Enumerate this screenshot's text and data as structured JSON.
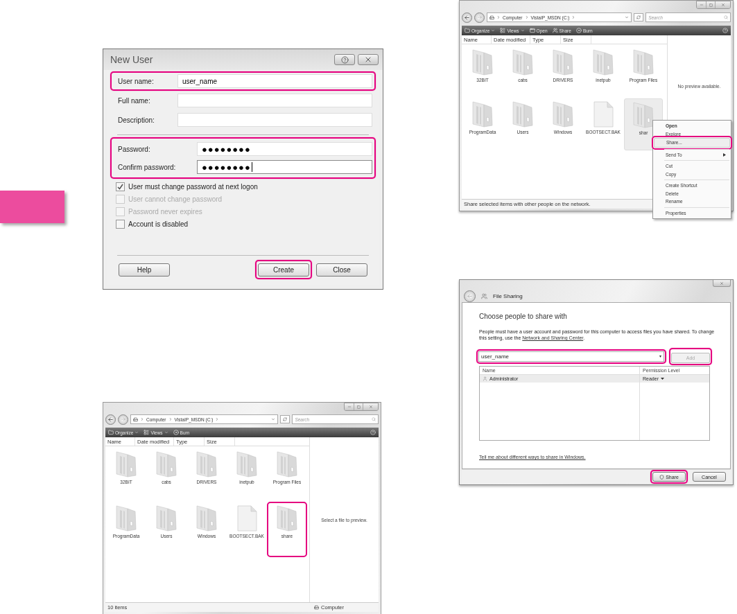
{
  "new_user_dialog": {
    "title": "New User",
    "name_fields": [
      {
        "label": "User name:",
        "value": "user_name",
        "highlighted": true
      },
      {
        "label": "Full name:",
        "highlighted": false
      },
      {
        "label": "Description:",
        "highlighted": false
      }
    ],
    "password_group": {
      "highlighted": true,
      "fields": [
        {
          "label": "Password:",
          "value": "●●●●●●●●",
          "caret": false
        },
        {
          "label": "Confirm password:",
          "value": "●●●●●●●●",
          "caret": true
        }
      ]
    },
    "options": [
      {
        "label": "User must change password at next logon",
        "checked": true,
        "disabled": false
      },
      {
        "label": "User cannot change password",
        "checked": false,
        "disabled": true
      },
      {
        "label": "Password never expires",
        "checked": false,
        "disabled": true
      },
      {
        "label": "Account is disabled",
        "checked": false,
        "disabled": false
      }
    ],
    "buttons": [
      {
        "label": "Help",
        "highlighted": false
      },
      {
        "label": "Create",
        "highlighted": true
      },
      {
        "label": "Close",
        "highlighted": false
      }
    ]
  },
  "explorer_windows": [
    {
      "path": [
        "Computer",
        "VistaIP_MSDN (C:)"
      ],
      "search_placeholder": "Search",
      "toolbar": [
        {
          "label": "Organize",
          "kind": "organize",
          "dropdown": true
        },
        {
          "label": "Views",
          "kind": "views",
          "dropdown": true
        },
        {
          "label": "Burn",
          "kind": "burn",
          "dropdown": false
        }
      ],
      "columns": [
        "Name",
        "Date modified",
        "Type",
        "Size"
      ],
      "items": [
        {
          "label": "32BIT",
          "kind": "folder",
          "selected": false,
          "highlighted": false
        },
        {
          "label": "cabs",
          "kind": "folder",
          "selected": false,
          "highlighted": false
        },
        {
          "label": "DRIVERS",
          "kind": "folder",
          "selected": false,
          "highlighted": false
        },
        {
          "label": "inetpub",
          "kind": "folder",
          "selected": false,
          "highlighted": false
        },
        {
          "label": "Program Files",
          "kind": "folder",
          "selected": false,
          "highlighted": false
        },
        {
          "label": "ProgramData",
          "kind": "folder",
          "selected": false,
          "highlighted": false
        },
        {
          "label": "Users",
          "kind": "folder",
          "selected": false,
          "highlighted": false
        },
        {
          "label": "Windows",
          "kind": "folder",
          "selected": false,
          "highlighted": false
        },
        {
          "label": "BOOTSECT.BAK",
          "kind": "file",
          "selected": false,
          "highlighted": false
        },
        {
          "label": "share",
          "kind": "folder",
          "selected": false,
          "highlighted": true
        }
      ],
      "preview_text": "Select a file to preview.",
      "status": {
        "text": "10 items",
        "location": "Computer"
      }
    },
    {
      "path": [
        "Computer",
        "VistaIP_MSDN (C:)"
      ],
      "search_placeholder": "Search",
      "toolbar": [
        {
          "label": "Organize",
          "kind": "organize",
          "dropdown": true
        },
        {
          "label": "Views",
          "kind": "views",
          "dropdown": true
        },
        {
          "label": "Open",
          "kind": "open",
          "dropdown": false
        },
        {
          "label": "Share",
          "kind": "share",
          "dropdown": false
        },
        {
          "label": "Burn",
          "kind": "burn",
          "dropdown": false
        }
      ],
      "columns": [
        "Name",
        "Date modified",
        "Type",
        "Size"
      ],
      "items": [
        {
          "label": "32BIT",
          "kind": "folder",
          "selected": false,
          "highlighted": false
        },
        {
          "label": "cabs",
          "kind": "folder",
          "selected": false,
          "highlighted": false
        },
        {
          "label": "DRIVERS",
          "kind": "folder",
          "selected": false,
          "highlighted": false
        },
        {
          "label": "inetpub",
          "kind": "folder",
          "selected": false,
          "highlighted": false
        },
        {
          "label": "Program Files",
          "kind": "folder",
          "selected": false,
          "highlighted": false
        },
        {
          "label": "ProgramData",
          "kind": "folder",
          "selected": false,
          "highlighted": false
        },
        {
          "label": "Users",
          "kind": "folder",
          "selected": false,
          "highlighted": false
        },
        {
          "label": "Windows",
          "kind": "folder",
          "selected": false,
          "highlighted": false
        },
        {
          "label": "BOOTSECT.BAK",
          "kind": "file",
          "selected": false,
          "highlighted": false
        },
        {
          "label": "shar",
          "kind": "folder",
          "selected": true,
          "highlighted": false
        }
      ],
      "preview_text": "No preview available.",
      "status": {
        "text": "Share selected items with other people on the network."
      },
      "context_menu": [
        {
          "kind": "item",
          "label": "Open",
          "default": true,
          "highlighted": false,
          "submenu": false
        },
        {
          "kind": "item",
          "label": "Explore",
          "default": false,
          "highlighted": false,
          "submenu": false
        },
        {
          "kind": "item",
          "label": "Share...",
          "default": false,
          "highlighted": true,
          "submenu": false
        },
        {
          "kind": "separator"
        },
        {
          "kind": "item",
          "label": "Send To",
          "default": false,
          "highlighted": false,
          "submenu": true
        },
        {
          "kind": "separator"
        },
        {
          "kind": "item",
          "label": "Cut",
          "default": false,
          "highlighted": false,
          "submenu": false
        },
        {
          "kind": "item",
          "label": "Copy",
          "default": false,
          "highlighted": false,
          "submenu": false
        },
        {
          "kind": "separator"
        },
        {
          "kind": "item",
          "label": "Create Shortcut",
          "default": false,
          "highlighted": false,
          "submenu": false
        },
        {
          "kind": "item",
          "label": "Delete",
          "default": false,
          "highlighted": false,
          "submenu": false
        },
        {
          "kind": "item",
          "label": "Rename",
          "default": false,
          "highlighted": false,
          "submenu": false
        },
        {
          "kind": "separator"
        },
        {
          "kind": "item",
          "label": "Properties",
          "default": false,
          "highlighted": false,
          "submenu": false
        }
      ]
    }
  ],
  "file_sharing": {
    "title": "File Sharing",
    "heading": "Choose people to share with",
    "description": {
      "text": "People must have a user account and password for this computer to access files you have shared.  To change this setting, use the",
      "link": "Network and Sharing Center",
      "end": "."
    },
    "person_field": {
      "value": "user_name",
      "highlighted": true
    },
    "add_button": {
      "label": "Add",
      "disabled": true,
      "highlighted": true
    },
    "table": {
      "columns": [
        "Name",
        "Permission Level"
      ],
      "rows": [
        {
          "name": "Administrator",
          "permission": "Reader",
          "selected": true
        }
      ]
    },
    "help_link": "Tell me about different ways to share in Windows.",
    "buttons": [
      {
        "label": "Share",
        "kind": "shield",
        "highlighted": true
      },
      {
        "label": "Cancel",
        "kind": "plain",
        "highlighted": false
      }
    ]
  }
}
